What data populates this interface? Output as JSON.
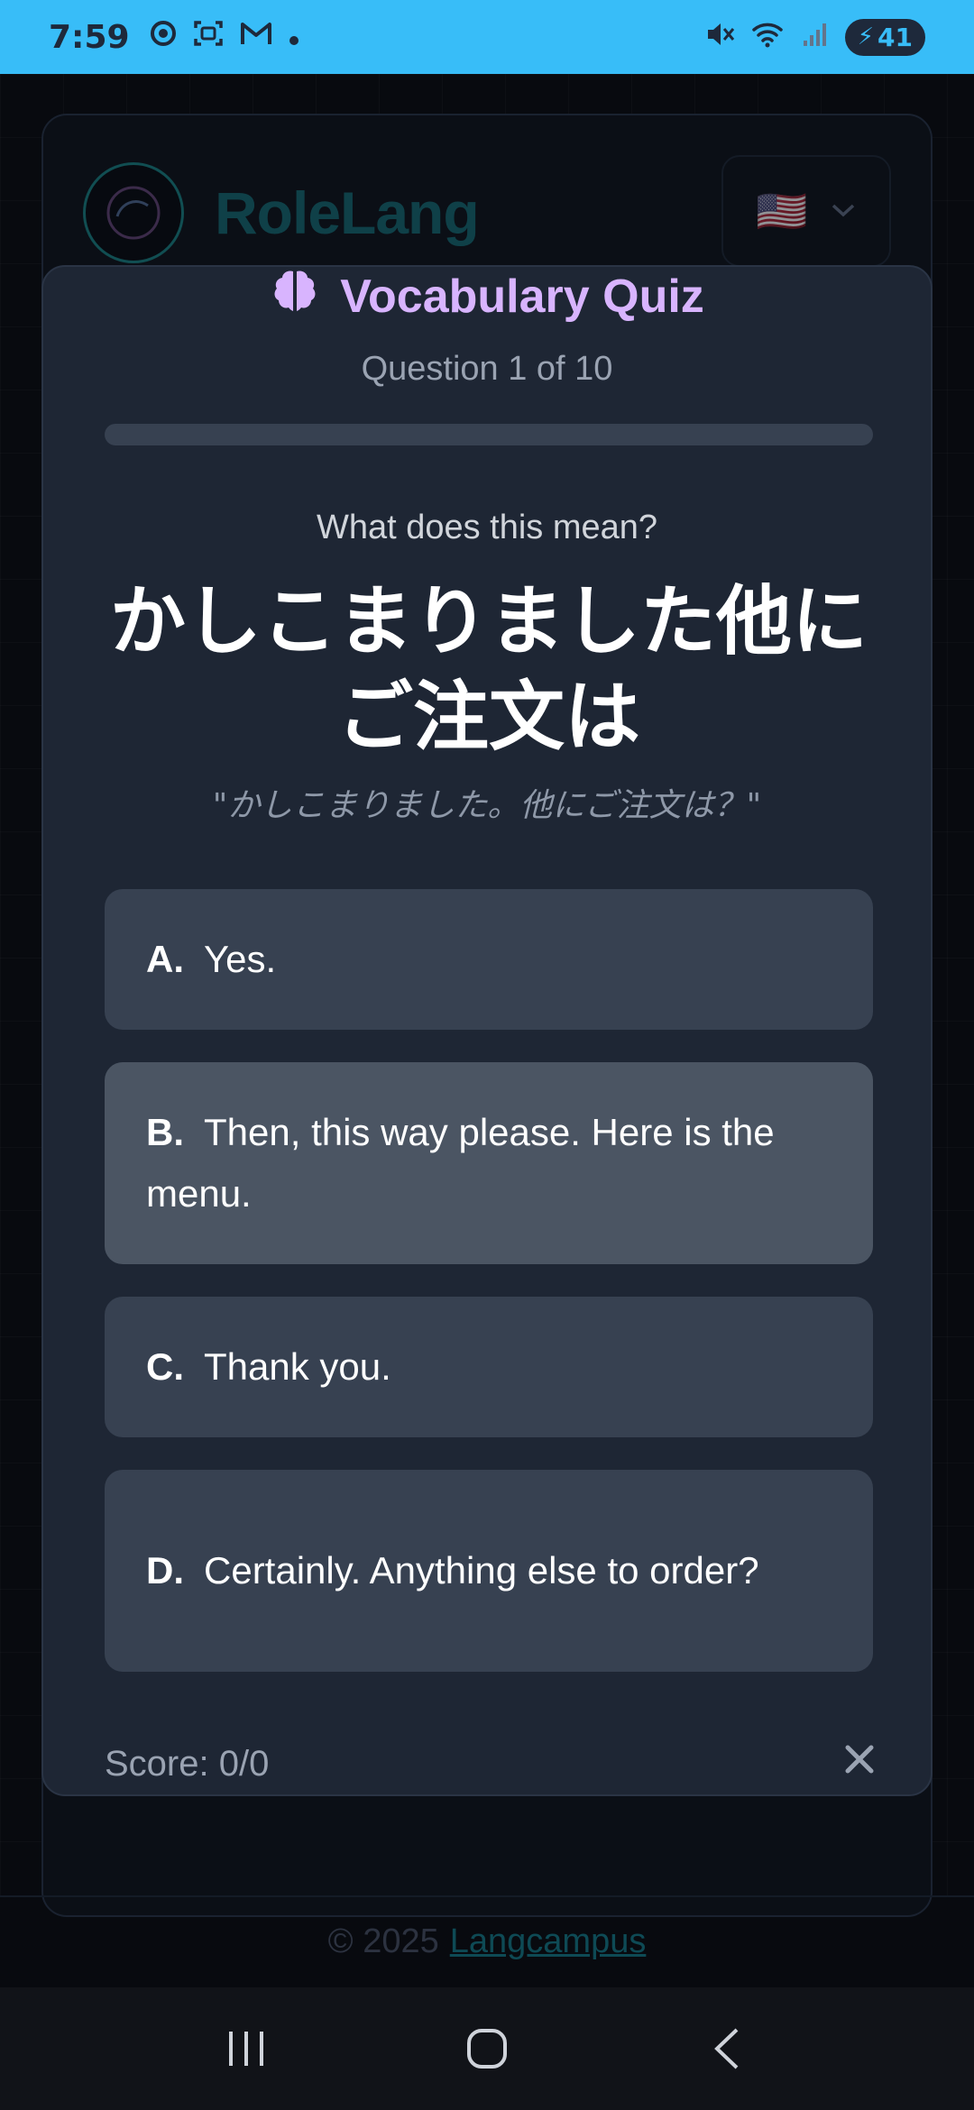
{
  "status_bar": {
    "time": "7:59",
    "left_icons": [
      "chrome-icon",
      "screenshot-icon",
      "gmail-icon",
      "dot-icon"
    ],
    "battery": "41",
    "right_icons": [
      "mute-icon",
      "wifi-icon",
      "signal-icon",
      "battery-icon"
    ]
  },
  "background_app": {
    "brand": "RoleLang",
    "language_flag": "🇺🇸",
    "footer_prefix": "© 2025",
    "footer_link": "Langcampus"
  },
  "quiz": {
    "title": "Vocabulary Quiz",
    "title_icon": "brain-icon",
    "question_counter": "Question 1 of 10",
    "progress": 0,
    "prompt": "What does this mean?",
    "phrase": "かしこまりました他にご注文は",
    "quote": "\"かしこまりました。他にご注文は？\"",
    "options": [
      {
        "letter": "A.",
        "text": "Yes."
      },
      {
        "letter": "B.",
        "text": "Then, this way please. Here is the menu."
      },
      {
        "letter": "C.",
        "text": "Thank you."
      },
      {
        "letter": "D.",
        "text": "Certainly. Anything else to order?"
      }
    ],
    "score": "Score: 0/0"
  },
  "colors": {
    "status_bar": "#38bdf8",
    "modal_bg": "#1e2634",
    "option_bg": "#374151",
    "option_hover_bg": "#4b5563",
    "title": "#d8b4fe"
  }
}
